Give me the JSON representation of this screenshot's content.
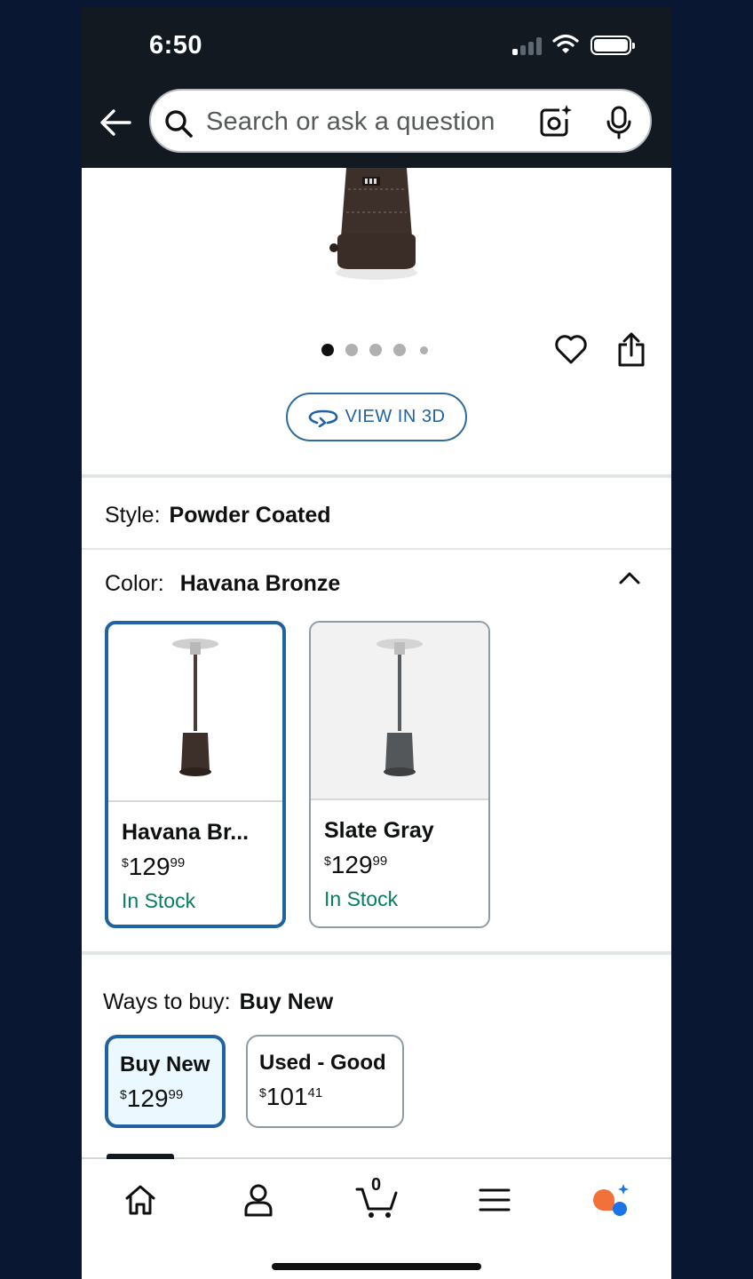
{
  "status_bar": {
    "time": "6:50"
  },
  "search": {
    "placeholder": "Search or ask a question"
  },
  "gallery": {
    "view_3d_label": "VIEW IN 3D",
    "page_dots": 5,
    "active_dot": 1
  },
  "style": {
    "label": "Style:",
    "value": "Powder Coated"
  },
  "color": {
    "label": "Color:",
    "value": "Havana Bronze",
    "options": [
      {
        "name": "Havana Br...",
        "price_symbol": "$",
        "price_whole": "129",
        "price_cents": "99",
        "stock": "In Stock",
        "selected": true
      },
      {
        "name": "Slate Gray",
        "price_symbol": "$",
        "price_whole": "129",
        "price_cents": "99",
        "stock": "In Stock",
        "selected": false
      }
    ]
  },
  "ways_to_buy": {
    "label": "Ways to buy:",
    "value": "Buy New",
    "options": [
      {
        "title": "Buy New",
        "price_symbol": "$",
        "price_whole": "129",
        "price_cents": "99",
        "selected": true
      },
      {
        "title": "Used - Good",
        "price_symbol": "$",
        "price_whole": "101",
        "price_cents": "41",
        "selected": false
      }
    ]
  },
  "nav": {
    "cart_count": "0",
    "accent_color": "#f2703a",
    "ai_color": "#1a73e8"
  },
  "colors": {
    "header_bg": "#131921",
    "link_blue": "#2162a1",
    "stock_green": "#067d62"
  }
}
